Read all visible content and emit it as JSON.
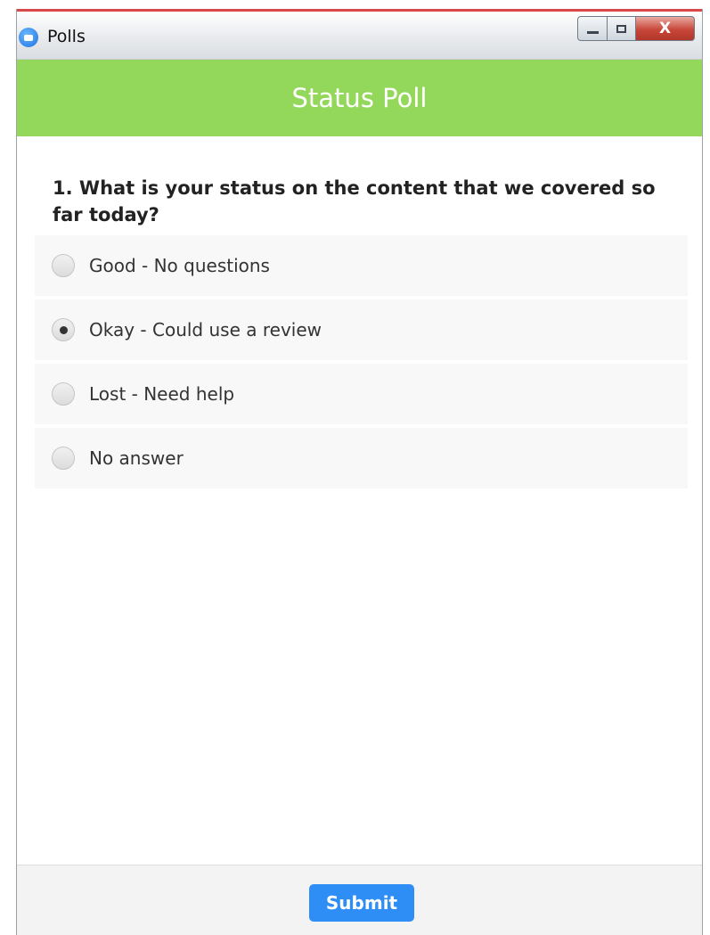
{
  "window": {
    "title": "Polls",
    "close_glyph": "X",
    "icon": "zoom-camera-icon"
  },
  "header": {
    "title": "Status Poll",
    "color": "#93d85a"
  },
  "question": {
    "text": "1. What is your status on the content that we covered so far today?"
  },
  "options": [
    {
      "label": "Good - No questions",
      "selected": false
    },
    {
      "label": "Okay - Could use a review",
      "selected": true
    },
    {
      "label": "Lost - Need help",
      "selected": false
    },
    {
      "label": "No answer",
      "selected": false
    }
  ],
  "footer": {
    "submit_label": "Submit",
    "submit_color": "#2e8ef5"
  }
}
